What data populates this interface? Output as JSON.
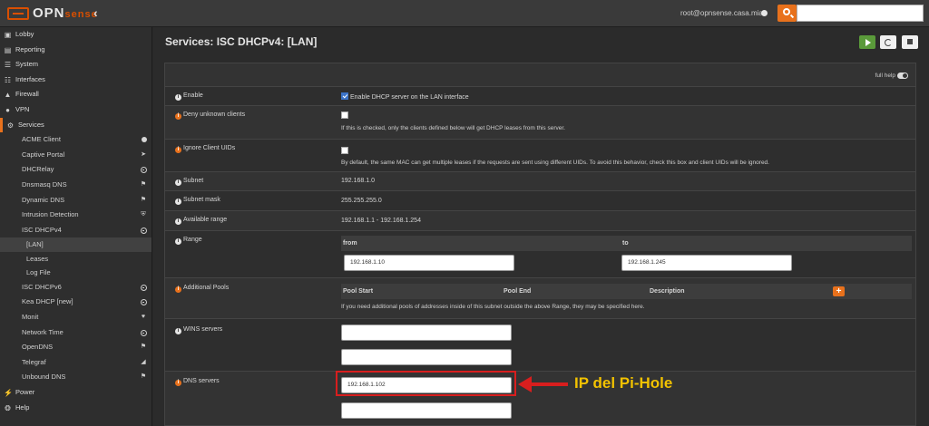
{
  "colors": {
    "accent": "#e8711c",
    "callout_red": "#d81e1e",
    "callout_yellow": "#f2c200",
    "start_green": "#5a9a3a"
  },
  "header": {
    "logo_text": "OPN",
    "logo_sub": "sense",
    "user": "root@opnsense.casa.mia",
    "search_placeholder": ""
  },
  "sidebar": {
    "items": [
      {
        "label": "Lobby",
        "icon": "laptop-icon"
      },
      {
        "label": "Reporting",
        "icon": "chart-icon"
      },
      {
        "label": "System",
        "icon": "server-icon"
      },
      {
        "label": "Interfaces",
        "icon": "sitemap-icon"
      },
      {
        "label": "Firewall",
        "icon": "fire-icon"
      },
      {
        "label": "VPN",
        "icon": "globe-icon"
      },
      {
        "label": "Services",
        "icon": "gear-icon"
      }
    ],
    "services": [
      {
        "label": "ACME Client",
        "icon": "dot-icon"
      },
      {
        "label": "Captive Portal",
        "icon": "send-icon"
      },
      {
        "label": "DHCRelay",
        "icon": "circle-icon"
      },
      {
        "label": "Dnsmasq DNS",
        "icon": "tags-icon"
      },
      {
        "label": "Dynamic DNS",
        "icon": "tags-icon"
      },
      {
        "label": "Intrusion Detection",
        "icon": "shield-icon"
      },
      {
        "label": "ISC DHCPv4",
        "icon": "circle-icon"
      }
    ],
    "dhcpv4_sub": [
      "[LAN]",
      "Leases",
      "Log File"
    ],
    "services2": [
      {
        "label": "ISC DHCPv6",
        "icon": "circle-icon"
      },
      {
        "label": "Kea DHCP [new]",
        "icon": "circle-icon"
      },
      {
        "label": "Monit",
        "icon": "heartbeat-icon"
      },
      {
        "label": "Network Time",
        "icon": "clock-icon"
      },
      {
        "label": "OpenDNS",
        "icon": "tags-icon"
      },
      {
        "label": "Telegraf",
        "icon": "area-chart-icon"
      },
      {
        "label": "Unbound DNS",
        "icon": "tags-icon"
      }
    ],
    "bottom": [
      {
        "label": "Power",
        "icon": "plug-icon"
      },
      {
        "label": "Help",
        "icon": "lifebuoy-icon"
      }
    ]
  },
  "main": {
    "title": "Services: ISC DHCPv4: [LAN]",
    "full_help": "full help",
    "enable": {
      "label": "Enable",
      "checkbox_label": "Enable DHCP server on the LAN interface"
    },
    "deny_unknown": {
      "label": "Deny unknown clients",
      "hint": "If this is checked, only the clients defined below will get DHCP leases from this server."
    },
    "ignore_uids": {
      "label": "Ignore Client UIDs",
      "hint": "By default, the same MAC can get multiple leases if the requests are sent using different UIDs. To avoid this behavior, check this box and client UIDs will be ignored."
    },
    "subnet": {
      "label": "Subnet",
      "value": "192.168.1.0"
    },
    "subnet_mask": {
      "label": "Subnet mask",
      "value": "255.255.255.0"
    },
    "available_range": {
      "label": "Available range",
      "value": "192.168.1.1 - 192.168.1.254"
    },
    "range": {
      "label": "Range",
      "from_label": "from",
      "to_label": "to",
      "from_value": "192.168.1.10",
      "to_value": "192.168.1.245"
    },
    "pools": {
      "label": "Additional Pools",
      "col_start": "Pool Start",
      "col_end": "Pool End",
      "col_desc": "Description",
      "add": "+",
      "hint": "If you need additional pools of addresses inside of this subnet outside the above Range, they may be specified here."
    },
    "wins": {
      "label": "WINS servers",
      "value1": "",
      "value2": ""
    },
    "dns": {
      "label": "DNS servers",
      "value1": "192.168.1.102",
      "value2": ""
    }
  },
  "annotation": {
    "text": "IP del Pi-Hole"
  }
}
